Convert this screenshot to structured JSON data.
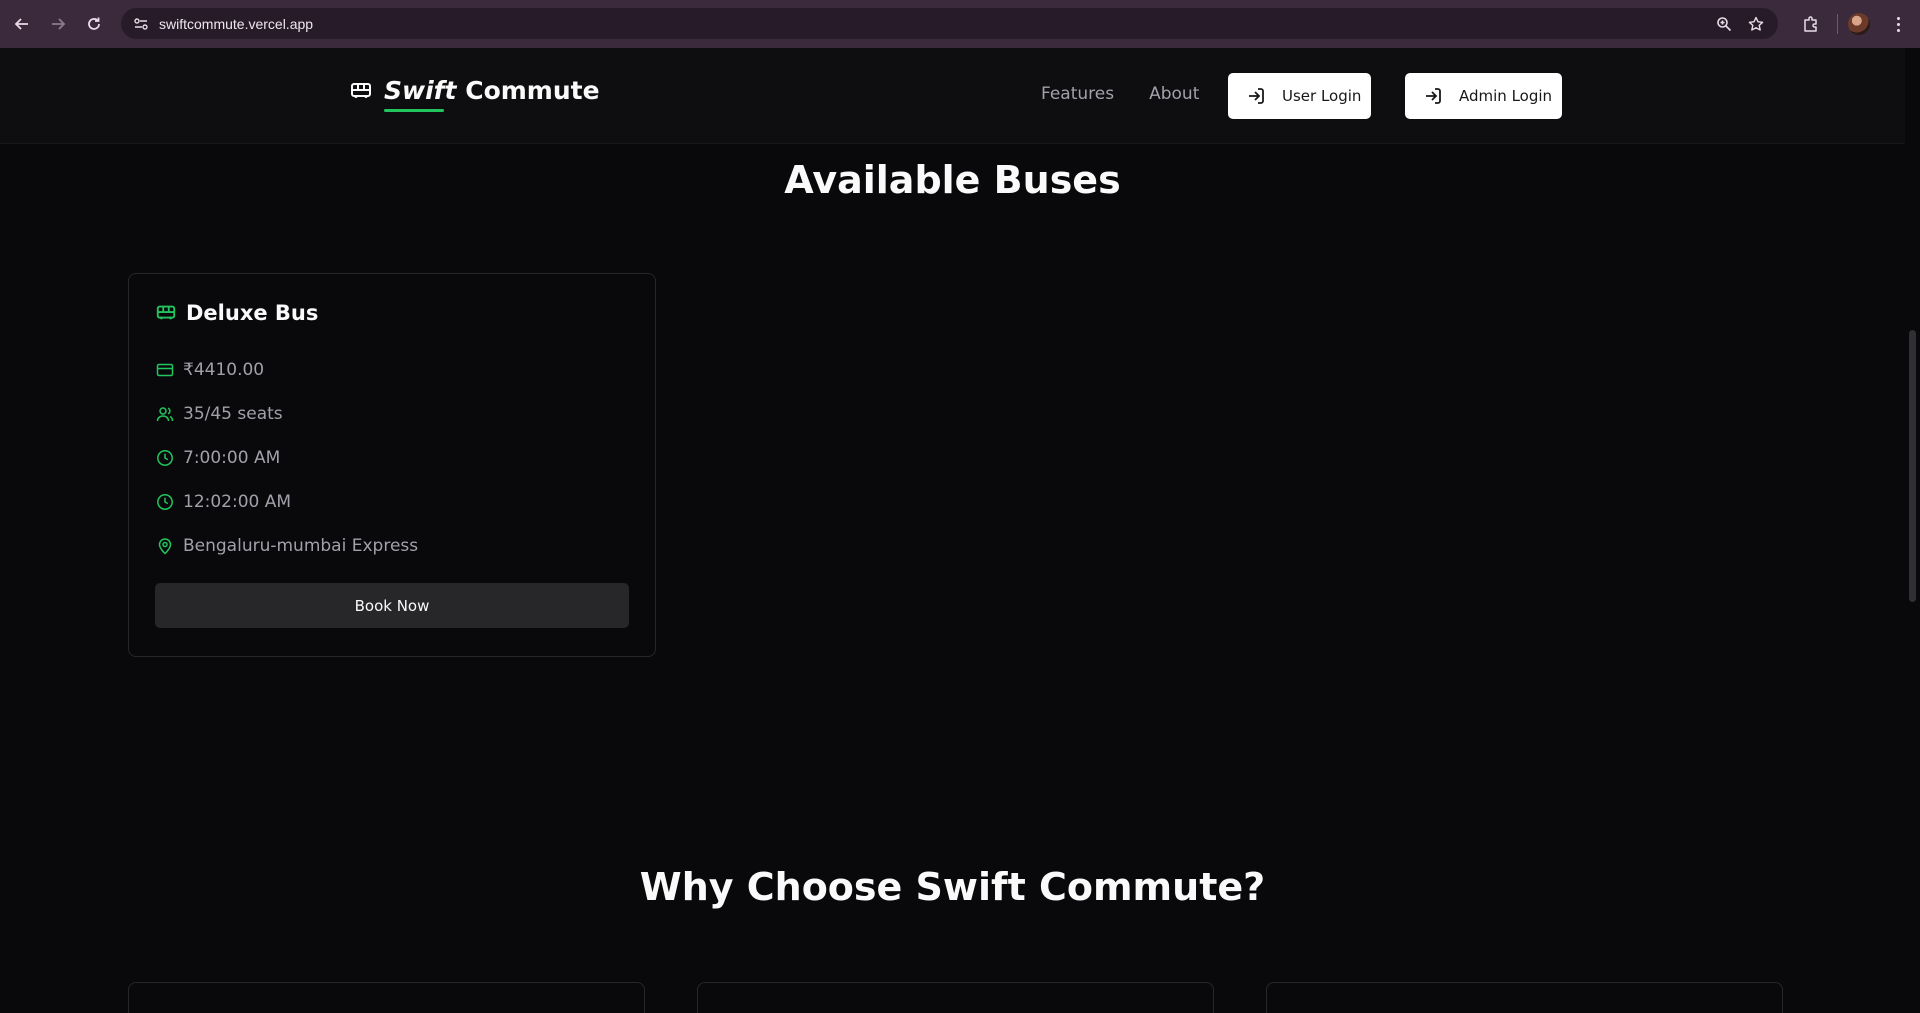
{
  "browser": {
    "url": "swiftcommute.vercel.app",
    "icons": [
      "back-icon",
      "forward-icon",
      "reload-icon",
      "site-info-icon",
      "zoom-icon",
      "bookmark-star-icon",
      "extensions-icon",
      "profile-avatar",
      "menu-icon"
    ]
  },
  "header": {
    "brand_swift": "Swift",
    "brand_commute": "Commute",
    "nav": [
      "Features",
      "About"
    ],
    "user_login": "User Login",
    "admin_login": "Admin Login"
  },
  "buses_section": {
    "title": "Available Buses",
    "cards": [
      {
        "name": "Deluxe Bus",
        "price": "₹4410.00",
        "seats": "35/45 seats",
        "departure": "7:00:00 AM",
        "arrival": "12:02:00 AM",
        "route": "Bengaluru-mumbai Express",
        "button": "Book Now"
      }
    ]
  },
  "why_section": {
    "title": "Why Choose Swift Commute?"
  },
  "colors": {
    "accent": "#22c55e",
    "background": "#09090b",
    "chrome": "#3a2a3c"
  }
}
